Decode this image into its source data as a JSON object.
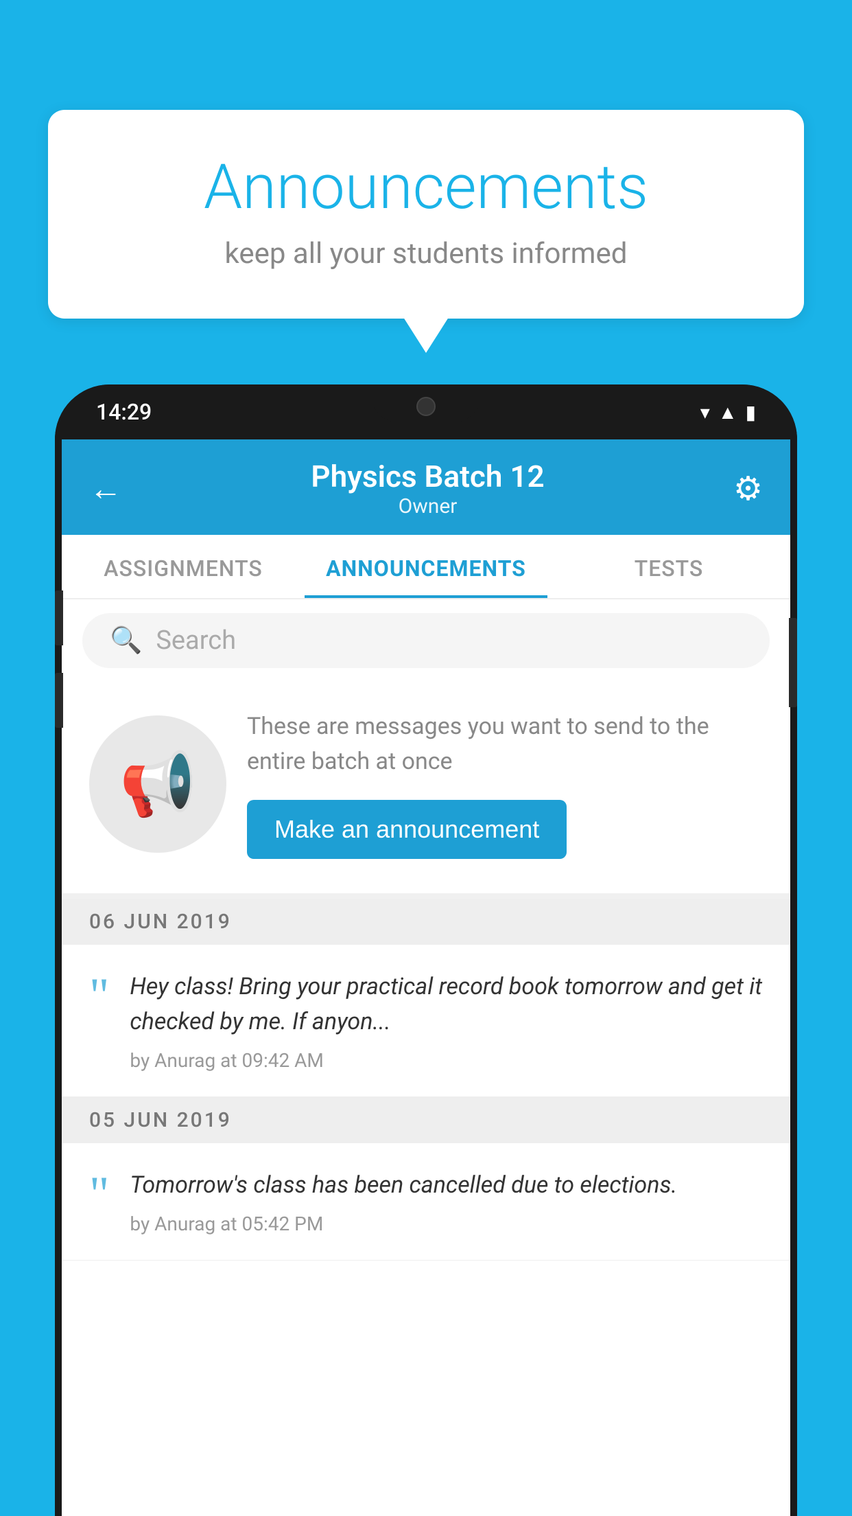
{
  "background": {
    "color": "#1ab3e8"
  },
  "speechBubble": {
    "title": "Announcements",
    "subtitle": "keep all your students informed"
  },
  "phone": {
    "statusBar": {
      "time": "14:29"
    },
    "header": {
      "title": "Physics Batch 12",
      "subtitle": "Owner",
      "backLabel": "←",
      "settingsLabel": "⚙"
    },
    "tabs": [
      {
        "label": "ASSIGNMENTS",
        "active": false
      },
      {
        "label": "ANNOUNCEMENTS",
        "active": true
      },
      {
        "label": "TESTS",
        "active": false
      }
    ],
    "search": {
      "placeholder": "Search"
    },
    "promo": {
      "description": "These are messages you want to send to the entire batch at once",
      "buttonLabel": "Make an announcement"
    },
    "announcements": [
      {
        "date": "06  JUN  2019",
        "text": "Hey class! Bring your practical record book tomorrow and get it checked by me. If anyon...",
        "meta": "by Anurag at 09:42 AM"
      },
      {
        "date": "05  JUN  2019",
        "text": "Tomorrow's class has been cancelled due to elections.",
        "meta": "by Anurag at 05:42 PM"
      }
    ]
  }
}
